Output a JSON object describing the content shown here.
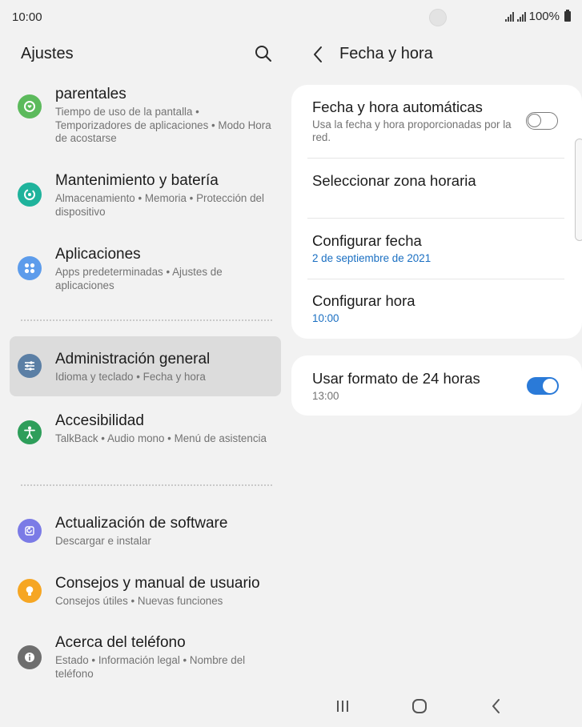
{
  "status_bar": {
    "time": "10:00",
    "battery": "100%"
  },
  "left_pane": {
    "title": "Ajustes",
    "items": [
      {
        "title": "parentales",
        "subtitle": "Tiempo de uso de la pantalla  •  Temporizadores de aplicaciones  •  Modo Hora de acostarse",
        "icon": "digital-wellbeing-icon",
        "color": "#5cba5c"
      },
      {
        "title": "Mantenimiento y batería",
        "subtitle": "Almacenamiento  •  Memoria  •  Protección del dispositivo",
        "icon": "device-care-icon",
        "color": "#1fb39c"
      },
      {
        "title": "Aplicaciones",
        "subtitle": "Apps predeterminadas  •  Ajustes de aplicaciones",
        "icon": "apps-icon",
        "color": "#5d9ceb"
      },
      {
        "title": "Administración general",
        "subtitle": "Idioma y teclado  •  Fecha y hora",
        "icon": "general-management-icon",
        "color": "#5b7fa5"
      },
      {
        "title": "Accesibilidad",
        "subtitle": "TalkBack  •  Audio mono  •  Menú de asistencia",
        "icon": "accessibility-icon",
        "color": "#2e9e5a"
      },
      {
        "title": "Actualización de software",
        "subtitle": "Descargar e instalar",
        "icon": "software-update-icon",
        "color": "#7b7be6"
      },
      {
        "title": "Consejos y manual de usuario",
        "subtitle": "Consejos útiles  •  Nuevas funciones",
        "icon": "tips-icon",
        "color": "#f6a623"
      },
      {
        "title": "Acerca del teléfono",
        "subtitle": "Estado  •  Información legal  •  Nombre del teléfono",
        "icon": "about-phone-icon",
        "color": "#6e6e6e"
      }
    ]
  },
  "right_pane": {
    "title": "Fecha y hora",
    "rows": {
      "auto": {
        "title": "Fecha y hora automáticas",
        "subtitle": "Usa la fecha y hora proporcionadas por la red.",
        "enabled": false
      },
      "timezone": {
        "title": "Seleccionar zona horaria"
      },
      "date": {
        "title": "Configurar fecha",
        "value": "2 de septiembre de 2021"
      },
      "time": {
        "title": "Configurar hora",
        "value": "10:00"
      },
      "format24": {
        "title": "Usar formato de 24 horas",
        "subtitle": "13:00",
        "enabled": true
      }
    }
  },
  "colors": {
    "accent": "#2a7ad8",
    "link": "#1a6fc2",
    "selected_bg": "#dcdcdc"
  }
}
